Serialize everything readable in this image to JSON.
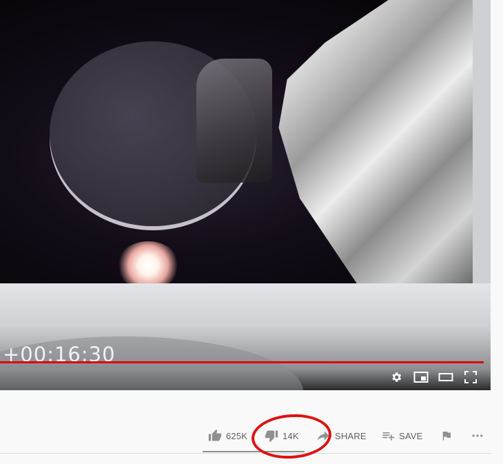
{
  "player": {
    "timecode": "+00:16:30",
    "progress_fraction": 0.99,
    "controls": [
      {
        "icon": "settings-icon"
      },
      {
        "icon": "miniplayer-icon"
      },
      {
        "icon": "theater-mode-icon"
      },
      {
        "icon": "fullscreen-icon"
      }
    ]
  },
  "actions": {
    "like_count": "625K",
    "dislike_count": "14K",
    "share_label": "SHARE",
    "save_label": "SAVE"
  },
  "colors": {
    "progress": "#e00000",
    "annotation": "#e01010",
    "action_text": "#606060"
  }
}
